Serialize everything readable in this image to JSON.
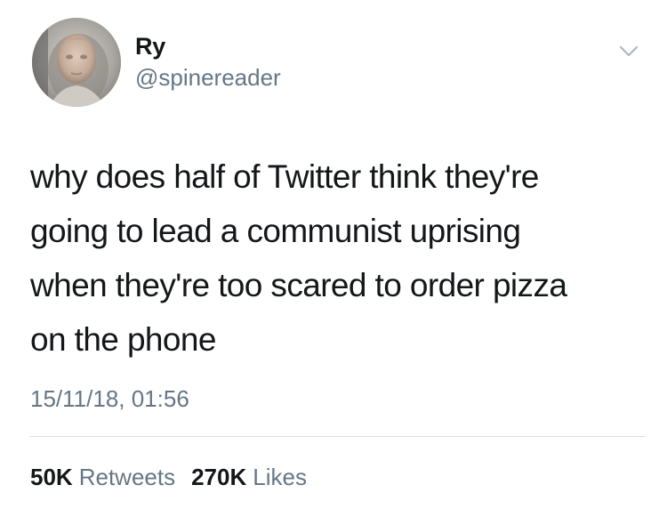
{
  "author": {
    "display_name": "Ry",
    "handle": "@spinereader",
    "avatar_icon": "profile-photo"
  },
  "tweet": {
    "text": "why does half of Twitter think they're\ngoing to lead a communist uprising\nwhen they're too scared to order pizza\non the phone",
    "timestamp": "15/11/18, 01:56"
  },
  "stats": {
    "retweets_count": "50K",
    "retweets_label": "Retweets",
    "likes_count": "270K",
    "likes_label": "Likes"
  },
  "icons": {
    "menu": "chevron-down-icon"
  },
  "colors": {
    "text_primary": "#14171a",
    "text_secondary": "#657786",
    "divider": "#d8dee2",
    "background": "#ffffff"
  }
}
